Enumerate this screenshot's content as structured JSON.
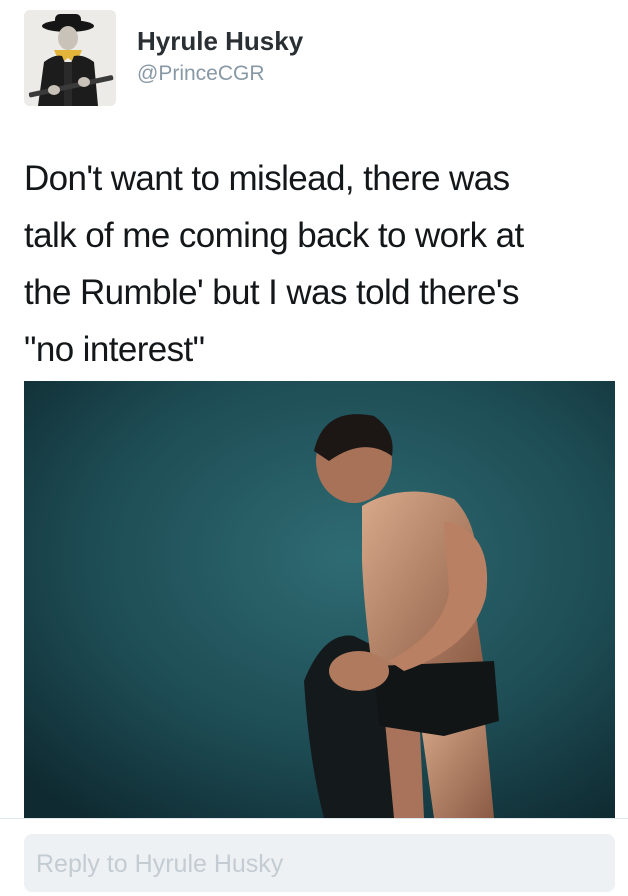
{
  "tweet": {
    "author": {
      "display_name": "Hyrule Husky",
      "username": "@PrinceCGR",
      "avatar_icon": "cowboy-portrait"
    },
    "text_lines": [
      "Don't want to mislead, there was",
      "talk of me coming back to work at",
      "the Rumble' but I was told there's",
      "\"no interest\""
    ],
    "media": {
      "type": "photo",
      "icon": "wrestler-photo"
    }
  },
  "reply": {
    "placeholder": "Reply to Hyrule Husky"
  },
  "colors": {
    "name": "#292f33",
    "username": "#8899a6",
    "text": "#14171a",
    "reply_bg": "#eef1f4",
    "reply_placeholder": "#c4ccd3",
    "photo_bg": "#1e4a52"
  }
}
